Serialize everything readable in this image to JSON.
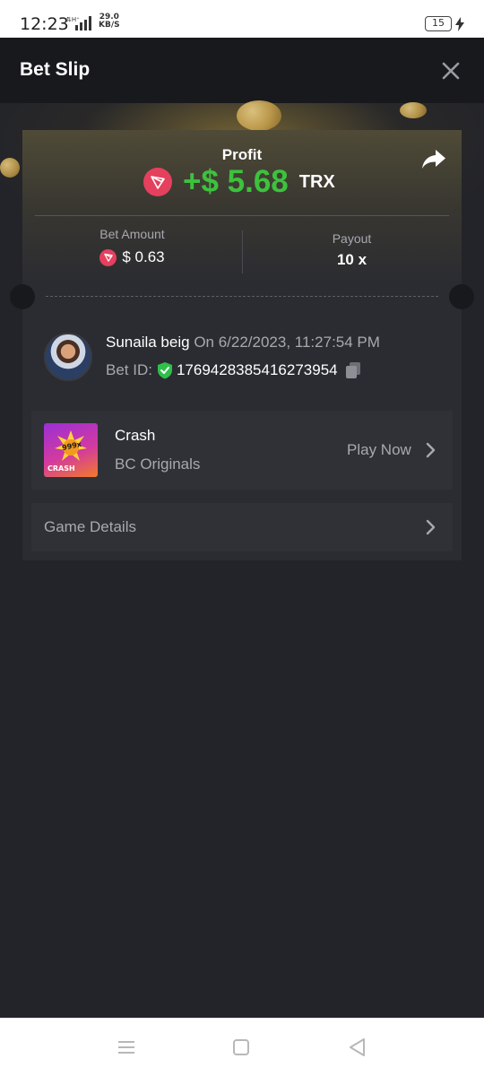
{
  "status_bar": {
    "time": "12:23",
    "network_speed_value": "29.0",
    "network_speed_unit": "KB/S",
    "battery_level": "15"
  },
  "header": {
    "title": "Bet Slip",
    "close_icon": "close-icon"
  },
  "summary": {
    "profit_label": "Profit",
    "profit_value": "+$ 5.68",
    "profit_currency": "TRX",
    "profit_color": "#3dc23d",
    "coin_color": "#e5405e",
    "bet_amount_label": "Bet Amount",
    "bet_amount_value": "$ 0.63",
    "payout_label": "Payout",
    "payout_value": "10 x"
  },
  "bet_info": {
    "username": "Sunaila beig",
    "date": "On 6/22/2023, 11:27:54 PM",
    "bet_id_label": "Bet ID:",
    "bet_id_value": "1769428385416273954"
  },
  "game": {
    "name": "Crash",
    "provider": "BC Originals",
    "play_label": "Play Now",
    "thumbnail_badge": "999x",
    "thumbnail_text": "CRASH"
  },
  "details": {
    "label": "Game Details"
  },
  "nav_bar": {
    "icons": [
      "menu-icon",
      "home-icon",
      "back-icon"
    ]
  }
}
